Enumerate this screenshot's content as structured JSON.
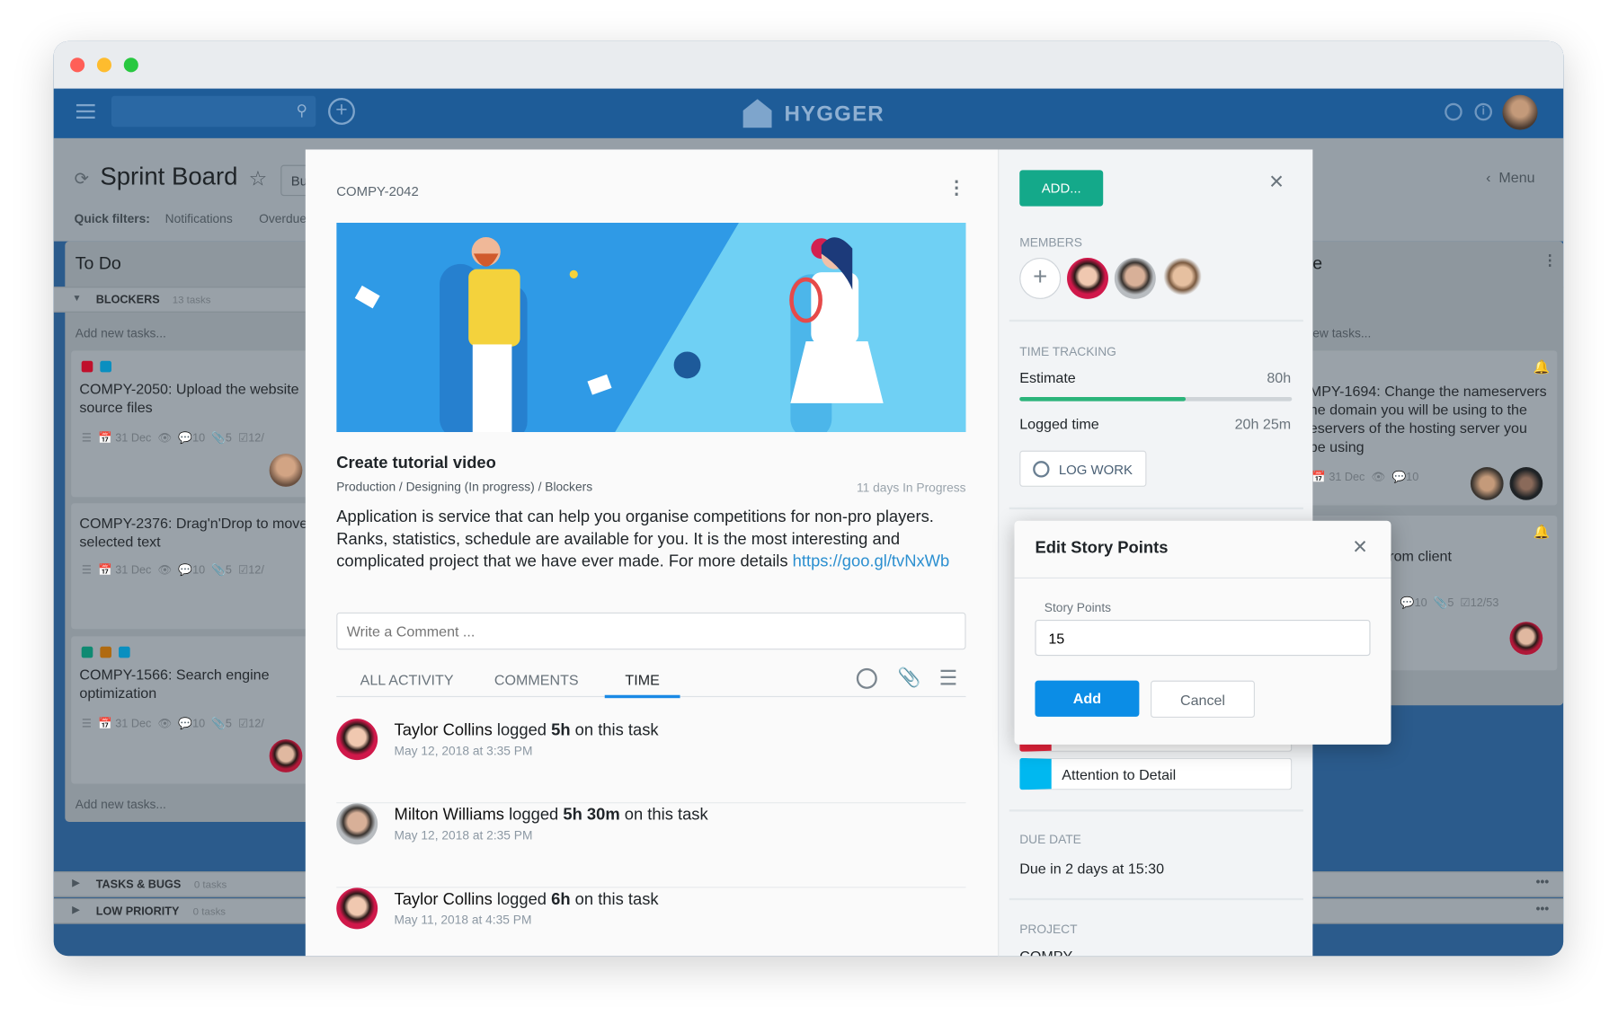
{
  "window": {
    "traffic_colors": [
      "#ff5f57",
      "#febc2e",
      "#28c840"
    ]
  },
  "topnav": {
    "logo": "HYGGER",
    "search_placeholder": ""
  },
  "board": {
    "title": "Sprint Board",
    "filter_button": "Bu",
    "quick_filters_label": "Quick filters:",
    "quick_filters": [
      "Notifications",
      "Overdue"
    ],
    "menu": "Menu",
    "todo": {
      "title": "To Do",
      "add_new": "Add new tasks...",
      "add_new_bottom": "Add new tasks..."
    },
    "swimlanes": [
      {
        "name": "BLOCKERS",
        "count": "13 tasks"
      },
      {
        "name": "TASKS & BUGS",
        "count": "0 tasks"
      },
      {
        "name": "LOW PRIORITY",
        "count": "0 tasks"
      }
    ],
    "cards": [
      {
        "title": "COMPY-2050: Upload the website source files",
        "date": "31 Dec",
        "comments": "10",
        "attachments": "5",
        "checklist": "12/",
        "tags": [
          "#c0102c",
          "#0a8fc0"
        ]
      },
      {
        "title": "COMPY-2376: Drag'n'Drop to move selected text",
        "date": "31 Dec",
        "comments": "10",
        "attachments": "5",
        "checklist": "12/",
        "tags": []
      },
      {
        "title": "COMPY-1566: Search engine optimization",
        "date": "31 Dec",
        "comments": "10",
        "attachments": "5",
        "checklist": "12/",
        "tags": [
          "#0f8a72",
          "#b06a10",
          "#0a8fc0"
        ]
      }
    ],
    "right_col": {
      "title": "e",
      "add_new": "ew tasks...",
      "card1": {
        "lines": [
          "MPY-1694: Change the nameservers",
          "he domain you will be using to the",
          "eservers of the hosting server you",
          "be using"
        ],
        "date": "31 Dec",
        "comments": "10"
      },
      "card2": {
        "text": "et approval from client",
        "comments": "10",
        "attachments": "5",
        "checklist": "12/53"
      }
    }
  },
  "task": {
    "id": "COMPY-2042",
    "title": "Create tutorial video",
    "breadcrumb": "Production / Designing (In progress) / Blockers",
    "age": "11 days In Progress",
    "description": "Application is service that can help you organise competitions for non-pro players. Ranks, statistics, schedule are available for you. It is the most interesting and complicated project that we have ever made. For more details ",
    "link": "https://goo.gl/tvNxWb",
    "comment_placeholder": "Write a Comment ...",
    "tabs": [
      {
        "label": "ALL ACTIVITY"
      },
      {
        "label": "COMMENTS"
      },
      {
        "label": "TIME",
        "active": true
      }
    ],
    "activity": [
      {
        "name": "Taylor Collins",
        "verb": " logged ",
        "amount": "5h",
        "suffix": " on this task",
        "date": "May 12, 2018 at 3:35 PM"
      },
      {
        "name": "Milton Williams",
        "verb": " logged ",
        "amount": "5h 30m",
        "suffix": " on this task",
        "date": "May 12, 2018 at 2:35 PM"
      },
      {
        "name": "Taylor Collins",
        "verb": " logged ",
        "amount": "6h",
        "suffix": " on this task",
        "date": "May 11, 2018 at 4:35 PM"
      }
    ]
  },
  "side": {
    "add_button": "ADD...",
    "members_label": "MEMBERS",
    "time_label": "TIME TRACKING",
    "estimate_label": "Estimate",
    "estimate": "80h",
    "logged_label": "Logged time",
    "logged": "20h 25m",
    "progress_fraction": 0.61,
    "log_work": "LOG WORK",
    "labels": [
      {
        "text": "",
        "color": "#e8223a"
      },
      {
        "text": "Attention to Detail",
        "color": "#00b8f0"
      }
    ],
    "due_label": "DUE DATE",
    "due": "Due in 2 days at 15:30",
    "project_label": "PROJECT",
    "project": "COMPY"
  },
  "popup": {
    "title": "Edit Story Points",
    "field_label": "Story Points",
    "value": "15",
    "add": "Add",
    "cancel": "Cancel"
  },
  "colors": {
    "accent_blue": "#0b8de6",
    "green": "#14a98a",
    "nav": "#1e5c98"
  }
}
